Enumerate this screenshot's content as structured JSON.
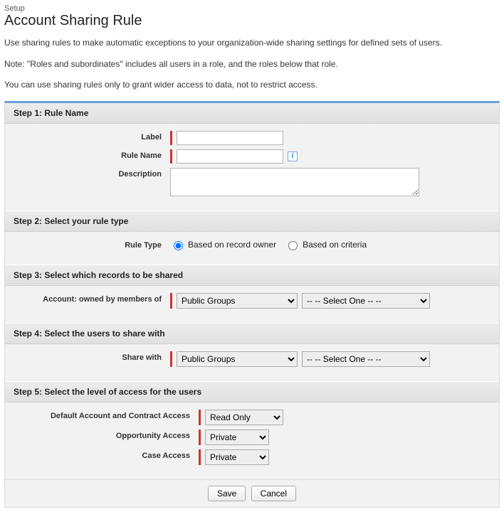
{
  "breadcrumb": "Setup",
  "title": "Account Sharing Rule",
  "intro": {
    "p1": "Use sharing rules to make automatic exceptions to your organization-wide sharing settings for defined sets of users.",
    "p2": "Note: \"Roles and subordinates\" includes all users in a role, and the roles below that role.",
    "p3": "You can use sharing rules only to grant wider access to data, not to restrict access."
  },
  "steps": {
    "s1": {
      "header": "Step 1: Rule Name",
      "labelLbl": "Label",
      "labelVal": "",
      "ruleNameLbl": "Rule Name",
      "ruleNameVal": "",
      "descLbl": "Description",
      "descVal": ""
    },
    "s2": {
      "header": "Step 2: Select your rule type",
      "ruleTypeLbl": "Rule Type",
      "opt1": "Based on record owner",
      "opt2": "Based on criteria"
    },
    "s3": {
      "header": "Step 3: Select which records to be shared",
      "ownedByLbl": "Account: owned by members of",
      "catSel": "Public Groups",
      "valSel": "-- -- Select One -- --"
    },
    "s4": {
      "header": "Step 4: Select the users to share with",
      "shareWithLbl": "Share with",
      "catSel": "Public Groups",
      "valSel": "-- -- Select One -- --"
    },
    "s5": {
      "header": "Step 5: Select the level of access for the users",
      "acctLbl": "Default Account and Contract Access",
      "acctSel": "Read Only",
      "oppLbl": "Opportunity Access",
      "oppSel": "Private",
      "caseLbl": "Case Access",
      "caseSel": "Private"
    }
  },
  "buttons": {
    "save": "Save",
    "cancel": "Cancel"
  }
}
